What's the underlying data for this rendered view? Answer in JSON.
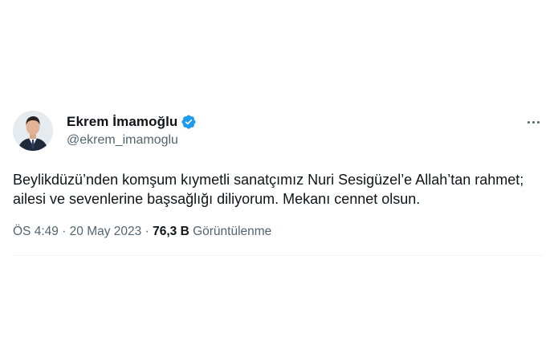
{
  "author": {
    "name": "Ekrem İmamoğlu",
    "handle": "@ekrem_imamoglu",
    "verified": true,
    "verified_color": "#1d9bf0"
  },
  "tweet": {
    "text": "Beylikdüzü’nden komşum kıymetli sanatçımız Nuri Sesigüzel’e Allah’tan rahmet; ailesi ve sevenlerine başsağlığı diliyorum. Mekanı cennet olsun."
  },
  "meta": {
    "time": "ÖS 4:49",
    "separator": "·",
    "date": "20 May 2023",
    "views_count": "76,3 B",
    "views_label": "Görüntülenme"
  },
  "icons": {
    "avatar": "profile-photo",
    "verified": "verified-badge-icon",
    "more": "more-options-icon"
  },
  "colors": {
    "text_primary": "#0f1419",
    "text_secondary": "#536471",
    "divider": "#eff3f4"
  }
}
